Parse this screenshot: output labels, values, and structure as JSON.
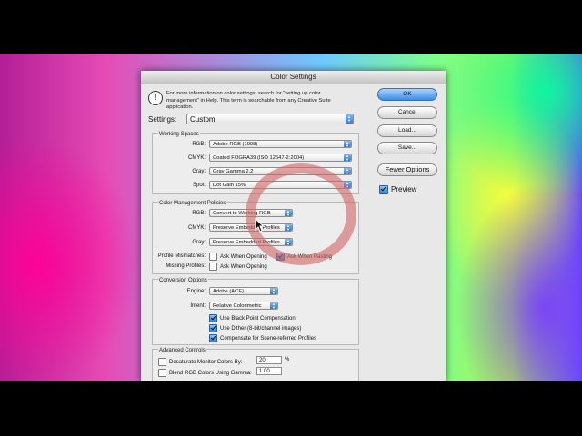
{
  "dialog": {
    "title": "Color Settings",
    "info_text": "For more information on color settings, search for \"setting up color management\" in Help. This term is searchable from any Creative Suite application.",
    "settings_label": "Settings:",
    "settings_value": "Custom"
  },
  "working_spaces": {
    "title": "Working Spaces",
    "rows": [
      {
        "label": "RGB:",
        "value": "Adobe RGB (1998)"
      },
      {
        "label": "CMYK:",
        "value": "Coated FOGRA39 (ISO 12647-2:2004)"
      },
      {
        "label": "Gray:",
        "value": "Gray Gamma 2.2"
      },
      {
        "label": "Spot:",
        "value": "Dot Gain 15%"
      }
    ]
  },
  "policies": {
    "title": "Color Management Policies",
    "rows": [
      {
        "label": "RGB:",
        "value": "Convert to Working RGB"
      },
      {
        "label": "CMYK:",
        "value": "Preserve Embedded Profiles"
      },
      {
        "label": "Gray:",
        "value": "Preserve Embedded Profiles"
      }
    ],
    "mismatch_label": "Profile Mismatches:",
    "ask_opening": "Ask When Opening",
    "ask_pasting": "Ask When Pasting",
    "missing_label": "Missing Profiles:",
    "missing_ask_opening": "Ask When Opening"
  },
  "conversion": {
    "title": "Conversion Options",
    "engine_label": "Engine:",
    "engine_value": "Adobe (ACE)",
    "intent_label": "Intent:",
    "intent_value": "Relative Colorimetric",
    "black_point": "Use Black Point Compensation",
    "dither": "Use Dither (8-bit/channel images)",
    "scene": "Compensate for Scene-referred Profiles"
  },
  "advanced": {
    "title": "Advanced Controls",
    "desaturate": "Desaturate Monitor Colors By:",
    "desaturate_value": "20",
    "desaturate_unit": "%",
    "blend": "Blend RGB Colors Using Gamma:",
    "blend_value": "1.00"
  },
  "buttons": {
    "ok": "OK",
    "cancel": "Cancel",
    "load": "Load...",
    "save": "Save...",
    "fewer": "Fewer Options",
    "preview": "Preview"
  },
  "checks": {
    "ask_opening": false,
    "ask_pasting": true,
    "missing_ask_opening": false,
    "black_point": true,
    "dither": true,
    "scene": true,
    "desaturate": false,
    "blend": false,
    "preview": true
  },
  "colors": {
    "accent": "#3a8ee6",
    "annotation_ring": "#d26969"
  },
  "icons": {
    "info": "exclamation-bubble-icon",
    "popup": "up-down-arrows-icon",
    "cursor": "arrow-cursor-icon"
  }
}
